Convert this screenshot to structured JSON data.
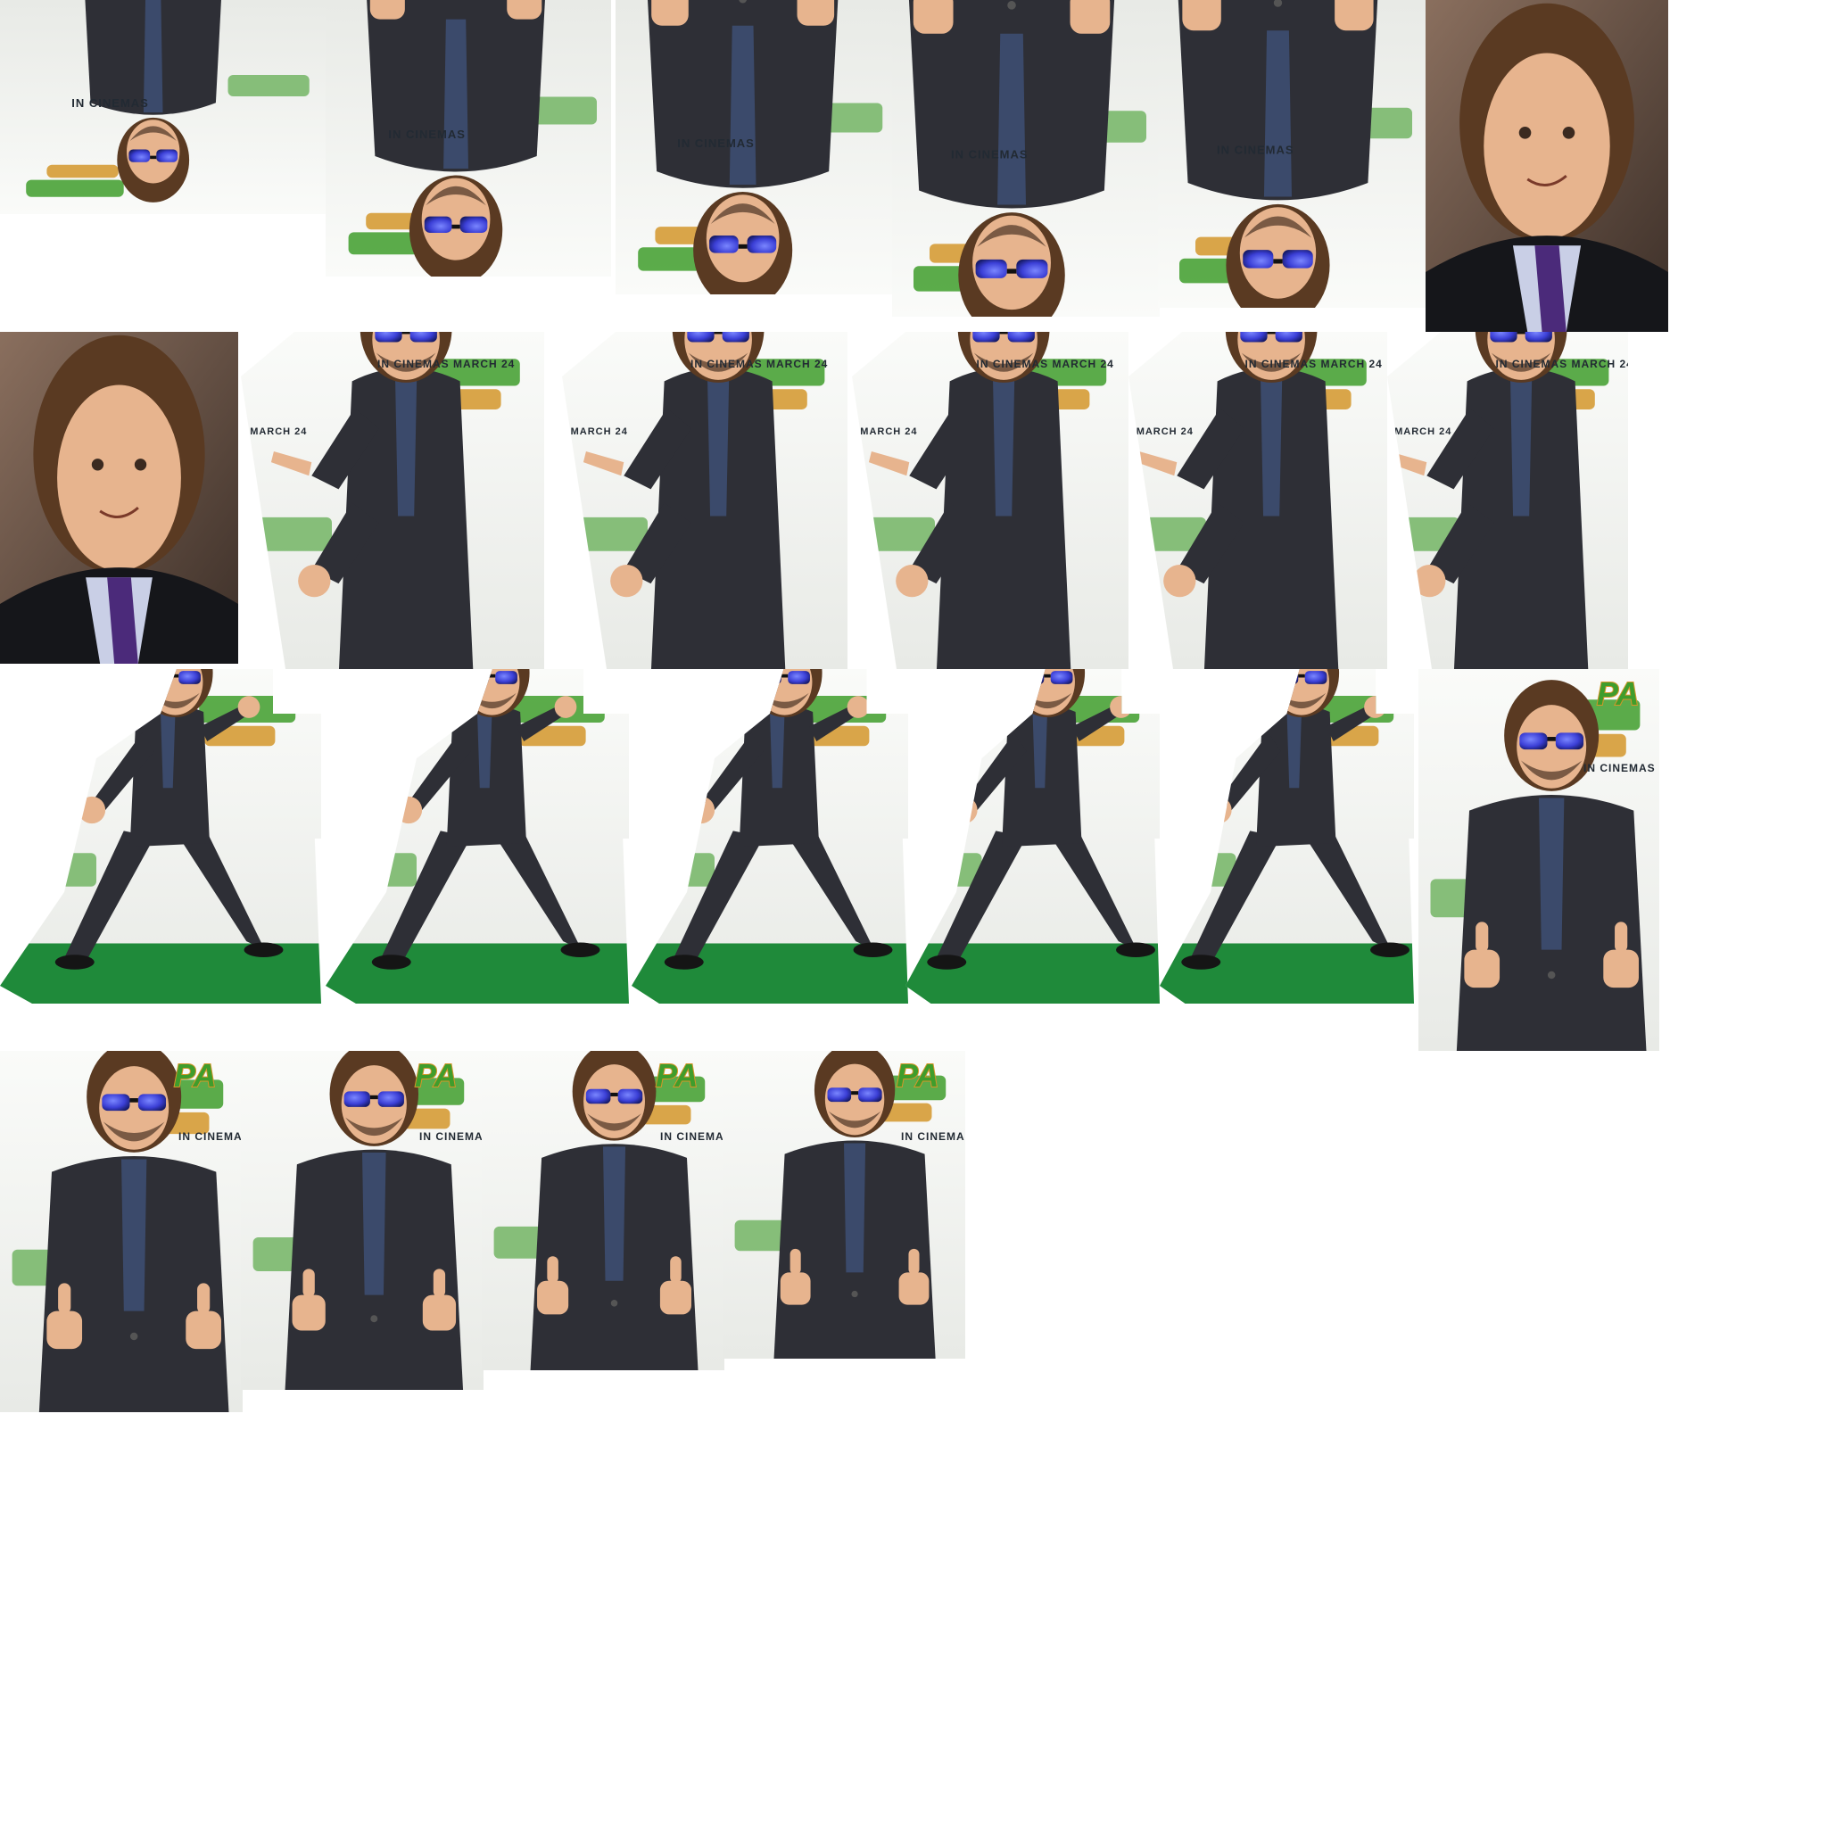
{
  "canvas": {
    "background": "#ffffff"
  },
  "backdrop_text": {
    "release_line": "IN CINEMAS",
    "release_line_full": "IN CINEMAS MARCH 24",
    "date_fragment": "MARCH 24",
    "brand_fragment": "PA"
  },
  "colors": {
    "suit": "#2e2f36",
    "shirt": "#3b4a6b",
    "skin": "#e7b48e",
    "hair": "#5a3a22",
    "lenses": "#3b3fd6",
    "tie": "#4b2a7a",
    "wall": "#f2f3f1",
    "carpet": "#1f8a3a",
    "brand_green": "#3f9d2c",
    "brand_orange": "#d4962a",
    "portrait_bg": "#7a5a4a"
  },
  "rows": [
    {
      "pose": "upside-down-thumbs-down",
      "count": 5
    },
    {
      "pose": "headshot-portrait",
      "count": 2
    },
    {
      "pose": "pointing-finger-guns",
      "count": 5
    },
    {
      "pose": "lunge-open-hand",
      "count": 5
    },
    {
      "pose": "thumbs-up",
      "count": 5
    }
  ]
}
